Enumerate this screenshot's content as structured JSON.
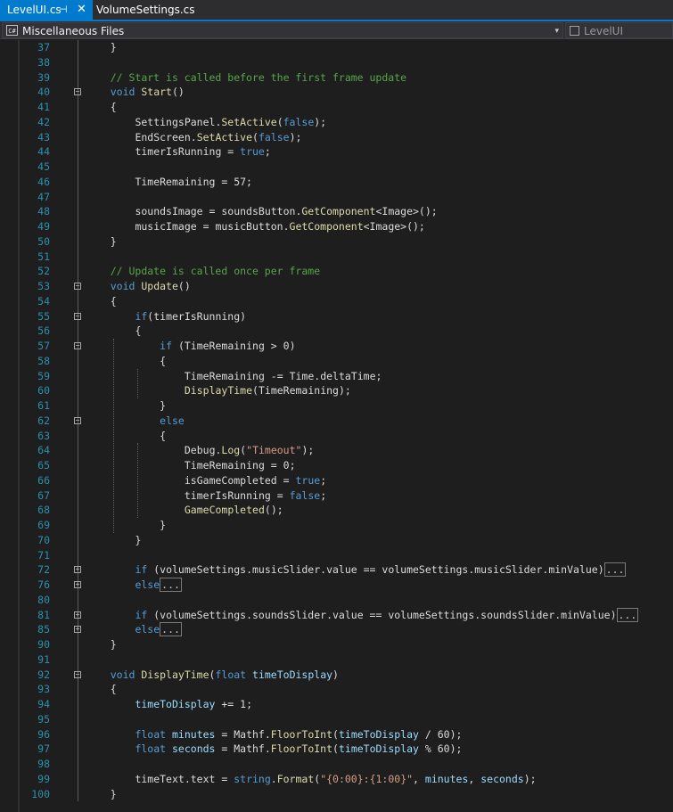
{
  "tabs": [
    {
      "label": "LevelUI.cs",
      "active": true,
      "pinned": true
    },
    {
      "label": "VolumeSettings.cs",
      "active": false
    }
  ],
  "nav": {
    "project": "Miscellaneous Files",
    "project_icon": "C#",
    "class_scope": "LevelUI"
  },
  "colors": {
    "accent": "#007acc",
    "background": "#1e1e1e",
    "line_number": "#2b91af",
    "keyword": "#569cd6",
    "comment": "#57a64a",
    "string": "#d69d85",
    "method": "#dcdcaa",
    "parameter": "#9cdcfe",
    "type": "#4ec9b0"
  },
  "lines": [
    {
      "n": "37",
      "indent": 1,
      "fold": "",
      "tokens": [
        [
          "t",
          "}"
        ]
      ]
    },
    {
      "n": "38",
      "indent": 0,
      "fold": "",
      "tokens": []
    },
    {
      "n": "39",
      "indent": 1,
      "fold": "",
      "tokens": [
        [
          "cm",
          "// Start is called before the first frame update"
        ]
      ]
    },
    {
      "n": "40",
      "indent": 1,
      "fold": "minus",
      "tokens": [
        [
          "kw",
          "void"
        ],
        [
          "t",
          " "
        ],
        [
          "fn",
          "Start"
        ],
        [
          "t",
          "()"
        ]
      ]
    },
    {
      "n": "41",
      "indent": 1,
      "fold": "",
      "tokens": [
        [
          "t",
          "{"
        ]
      ]
    },
    {
      "n": "42",
      "indent": 2,
      "fold": "",
      "tokens": [
        [
          "t",
          "SettingsPanel."
        ],
        [
          "fn",
          "SetActive"
        ],
        [
          "t",
          "("
        ],
        [
          "kw",
          "false"
        ],
        [
          "t",
          ");"
        ]
      ]
    },
    {
      "n": "43",
      "indent": 2,
      "fold": "",
      "tokens": [
        [
          "t",
          "EndScreen."
        ],
        [
          "fn",
          "SetActive"
        ],
        [
          "t",
          "("
        ],
        [
          "kw",
          "false"
        ],
        [
          "t",
          ");"
        ]
      ]
    },
    {
      "n": "44",
      "indent": 2,
      "fold": "",
      "tokens": [
        [
          "t",
          "timerIsRunning = "
        ],
        [
          "kw",
          "true"
        ],
        [
          "t",
          ";"
        ]
      ]
    },
    {
      "n": "45",
      "indent": 0,
      "fold": "",
      "tokens": []
    },
    {
      "n": "46",
      "indent": 2,
      "fold": "",
      "tokens": [
        [
          "t",
          "TimeRemaining = 57;"
        ]
      ]
    },
    {
      "n": "47",
      "indent": 0,
      "fold": "",
      "tokens": []
    },
    {
      "n": "48",
      "indent": 2,
      "fold": "",
      "tokens": [
        [
          "t",
          "soundsImage = soundsButton."
        ],
        [
          "fn",
          "GetComponent"
        ],
        [
          "t",
          "<Image>();"
        ]
      ]
    },
    {
      "n": "49",
      "indent": 2,
      "fold": "",
      "tokens": [
        [
          "t",
          "musicImage = musicButton."
        ],
        [
          "fn",
          "GetComponent"
        ],
        [
          "t",
          "<Image>();"
        ]
      ]
    },
    {
      "n": "50",
      "indent": 1,
      "fold": "",
      "tokens": [
        [
          "t",
          "}"
        ]
      ]
    },
    {
      "n": "51",
      "indent": 0,
      "fold": "",
      "tokens": []
    },
    {
      "n": "52",
      "indent": 1,
      "fold": "",
      "tokens": [
        [
          "cm",
          "// Update is called once per frame"
        ]
      ]
    },
    {
      "n": "53",
      "indent": 1,
      "fold": "minus",
      "tokens": [
        [
          "kw",
          "void"
        ],
        [
          "t",
          " "
        ],
        [
          "fn",
          "Update"
        ],
        [
          "t",
          "()"
        ]
      ]
    },
    {
      "n": "54",
      "indent": 1,
      "fold": "",
      "tokens": [
        [
          "t",
          "{"
        ]
      ]
    },
    {
      "n": "55",
      "indent": 2,
      "fold": "minus",
      "tokens": [
        [
          "kw",
          "if"
        ],
        [
          "t",
          "(timerIsRunning)"
        ]
      ]
    },
    {
      "n": "56",
      "indent": 2,
      "fold": "",
      "tokens": [
        [
          "t",
          "{"
        ]
      ]
    },
    {
      "n": "57",
      "indent": 3,
      "fold": "minus",
      "tokens": [
        [
          "kw",
          "if"
        ],
        [
          "t",
          " (TimeRemaining > 0)"
        ]
      ]
    },
    {
      "n": "58",
      "indent": 3,
      "fold": "",
      "tokens": [
        [
          "t",
          "{"
        ]
      ]
    },
    {
      "n": "59",
      "indent": 4,
      "fold": "",
      "tokens": [
        [
          "t",
          "TimeRemaining -= Time.deltaTime;"
        ]
      ]
    },
    {
      "n": "60",
      "indent": 4,
      "fold": "",
      "tokens": [
        [
          "fn",
          "DisplayTime"
        ],
        [
          "t",
          "(TimeRemaining);"
        ]
      ]
    },
    {
      "n": "61",
      "indent": 3,
      "fold": "",
      "tokens": [
        [
          "t",
          "}"
        ]
      ]
    },
    {
      "n": "62",
      "indent": 3,
      "fold": "minus",
      "tokens": [
        [
          "kw",
          "else"
        ]
      ]
    },
    {
      "n": "63",
      "indent": 3,
      "fold": "",
      "tokens": [
        [
          "t",
          "{"
        ]
      ]
    },
    {
      "n": "64",
      "indent": 4,
      "fold": "",
      "tokens": [
        [
          "t",
          "Debug."
        ],
        [
          "fn",
          "Log"
        ],
        [
          "t",
          "("
        ],
        [
          "st",
          "\"Timeout\""
        ],
        [
          "t",
          ");"
        ]
      ]
    },
    {
      "n": "65",
      "indent": 4,
      "fold": "",
      "tokens": [
        [
          "t",
          "TimeRemaining = 0;"
        ]
      ]
    },
    {
      "n": "66",
      "indent": 4,
      "fold": "",
      "tokens": [
        [
          "t",
          "isGameCompleted = "
        ],
        [
          "kw",
          "true"
        ],
        [
          "t",
          ";"
        ]
      ]
    },
    {
      "n": "67",
      "indent": 4,
      "fold": "",
      "tokens": [
        [
          "t",
          "timerIsRunning = "
        ],
        [
          "kw",
          "false"
        ],
        [
          "t",
          ";"
        ]
      ]
    },
    {
      "n": "68",
      "indent": 4,
      "fold": "",
      "tokens": [
        [
          "fn",
          "GameCompleted"
        ],
        [
          "t",
          "();"
        ]
      ]
    },
    {
      "n": "69",
      "indent": 3,
      "fold": "",
      "tokens": [
        [
          "t",
          "}"
        ]
      ]
    },
    {
      "n": "70",
      "indent": 2,
      "fold": "",
      "tokens": [
        [
          "t",
          "}"
        ]
      ]
    },
    {
      "n": "71",
      "indent": 0,
      "fold": "",
      "tokens": []
    },
    {
      "n": "72",
      "indent": 2,
      "fold": "plus",
      "tokens": [
        [
          "kw",
          "if"
        ],
        [
          "t",
          " (volumeSettings.musicSlider.value == volumeSettings.musicSlider.minValue)"
        ],
        [
          "box",
          "..."
        ]
      ]
    },
    {
      "n": "76",
      "indent": 2,
      "fold": "plus",
      "tokens": [
        [
          "kw",
          "else"
        ],
        [
          "box",
          "..."
        ]
      ]
    },
    {
      "n": "80",
      "indent": 0,
      "fold": "",
      "tokens": []
    },
    {
      "n": "81",
      "indent": 2,
      "fold": "plus",
      "tokens": [
        [
          "kw",
          "if"
        ],
        [
          "t",
          " (volumeSettings.soundsSlider.value == volumeSettings.soundsSlider.minValue)"
        ],
        [
          "box",
          "..."
        ]
      ]
    },
    {
      "n": "85",
      "indent": 2,
      "fold": "plus",
      "tokens": [
        [
          "kw",
          "else"
        ],
        [
          "box",
          "..."
        ]
      ]
    },
    {
      "n": "90",
      "indent": 1,
      "fold": "",
      "tokens": [
        [
          "t",
          "}"
        ]
      ]
    },
    {
      "n": "91",
      "indent": 0,
      "fold": "",
      "tokens": []
    },
    {
      "n": "92",
      "indent": 1,
      "fold": "minus",
      "tokens": [
        [
          "kw",
          "void"
        ],
        [
          "t",
          " "
        ],
        [
          "fn",
          "DisplayTime"
        ],
        [
          "t",
          "("
        ],
        [
          "kw",
          "float"
        ],
        [
          "t",
          " "
        ],
        [
          "pr",
          "timeToDisplay"
        ],
        [
          "t",
          ")"
        ]
      ]
    },
    {
      "n": "93",
      "indent": 1,
      "fold": "",
      "tokens": [
        [
          "t",
          "{"
        ]
      ]
    },
    {
      "n": "94",
      "indent": 2,
      "fold": "",
      "tokens": [
        [
          "pr",
          "timeToDisplay"
        ],
        [
          "t",
          " += 1;"
        ]
      ]
    },
    {
      "n": "95",
      "indent": 0,
      "fold": "",
      "tokens": []
    },
    {
      "n": "96",
      "indent": 2,
      "fold": "",
      "tokens": [
        [
          "kw",
          "float"
        ],
        [
          "t",
          " "
        ],
        [
          "pr",
          "minutes"
        ],
        [
          "t",
          " = Mathf."
        ],
        [
          "fn",
          "FloorToInt"
        ],
        [
          "t",
          "("
        ],
        [
          "pr",
          "timeToDisplay"
        ],
        [
          "t",
          " / 60);"
        ]
      ]
    },
    {
      "n": "97",
      "indent": 2,
      "fold": "",
      "tokens": [
        [
          "kw",
          "float"
        ],
        [
          "t",
          " "
        ],
        [
          "pr",
          "seconds"
        ],
        [
          "t",
          " = Mathf."
        ],
        [
          "fn",
          "FloorToInt"
        ],
        [
          "t",
          "("
        ],
        [
          "pr",
          "timeToDisplay"
        ],
        [
          "t",
          " % 60);"
        ]
      ]
    },
    {
      "n": "98",
      "indent": 0,
      "fold": "",
      "tokens": []
    },
    {
      "n": "99",
      "indent": 2,
      "fold": "",
      "tokens": [
        [
          "t",
          "timeText.text = "
        ],
        [
          "kw",
          "string"
        ],
        [
          "t",
          "."
        ],
        [
          "fn",
          "Format"
        ],
        [
          "t",
          "("
        ],
        [
          "st",
          "\"{0:00}:{1:00}\""
        ],
        [
          "t",
          ", "
        ],
        [
          "pr",
          "minutes"
        ],
        [
          "t",
          ", "
        ],
        [
          "pr",
          "seconds"
        ],
        [
          "t",
          ");"
        ]
      ]
    },
    {
      "n": "100",
      "indent": 1,
      "fold": "",
      "tokens": [
        [
          "t",
          "}"
        ]
      ]
    }
  ]
}
